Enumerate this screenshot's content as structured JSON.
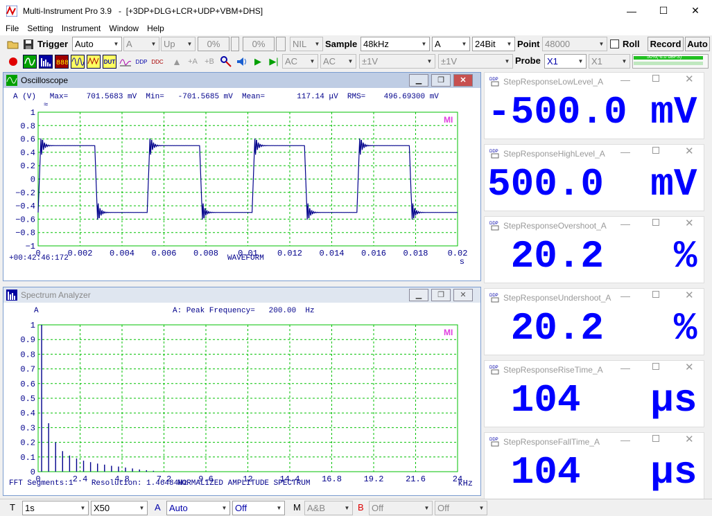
{
  "window": {
    "title": "Multi-Instrument Pro 3.9   -  [+3DP+DLG+LCR+UDP+VBM+DHS]",
    "controls": [
      "—",
      "☐",
      "✕"
    ]
  },
  "menu": [
    "File",
    "Setting",
    "Instrument",
    "Window",
    "Help"
  ],
  "toolbar1": {
    "trigger_label": "Trigger",
    "trigger_mode": "Auto",
    "trigger_channel": "A",
    "trigger_edge": "Up",
    "pct1": "0%",
    "pct2": "0%",
    "nil": "NIL",
    "sample_label": "Sample",
    "sample_rate": "48kHz",
    "channel": "A",
    "bits": "24Bit",
    "point_label": "Point",
    "points": "48000",
    "roll_label": "Roll",
    "record_label": "Record",
    "auto_label": "Auto"
  },
  "toolbar2": {
    "icon_dut": "DUT",
    "icon_ddp": "DDP",
    "icon_ddc": "DDC",
    "coupling_a": "AC",
    "coupling_b": "AC",
    "range_a": "±1V",
    "range_b": "±1V",
    "probe_label": "Probe",
    "probe_a": "X1",
    "probe_b": "X1",
    "level_meter": "50%(-6.0 dBFS)"
  },
  "oscilloscope": {
    "title": "Oscilloscope",
    "header": "A (V)   Max=    701.5683 mV  Min=   -701.5685 mV  Mean=       117.14 μV  RMS=    496.69300 mV",
    "mi": "MI",
    "y_ticks": [
      "1",
      "0.8",
      "0.6",
      "0.4",
      "0.2",
      "0",
      "−0.2",
      "−0.4",
      "−0.6",
      "−0.8",
      "−1"
    ],
    "x_ticks": [
      "0",
      "0.002",
      "0.004",
      "0.006",
      "0.008",
      "0.01",
      "0.012",
      "0.014",
      "0.016",
      "0.018",
      "0.02"
    ],
    "x_unit": "s",
    "timestamp": "+00:42:46:172",
    "footer": "WAVEFORM"
  },
  "spectrum": {
    "title": "Spectrum Analyzer",
    "channel": "A",
    "header": "A: Peak Frequency=   200.00  Hz",
    "mi": "MI",
    "y_ticks": [
      "1",
      "0.9",
      "0.8",
      "0.7",
      "0.6",
      "0.5",
      "0.4",
      "0.3",
      "0.2",
      "0.1",
      "0"
    ],
    "x_ticks": [
      "0",
      "2.4",
      "4.8",
      "7.2",
      "9.6",
      "12",
      "14.4",
      "16.8",
      "19.2",
      "21.6",
      "24"
    ],
    "x_unit": "kHz",
    "footer_left": "FFT Segments:1    Resolution: 1.46484Hz",
    "footer_center": "NORMALIZED AMPLITUDE SPECTRUM"
  },
  "ddp_meters": [
    {
      "title": "StepResponseLowLevel_A",
      "value": "-500.0 mV"
    },
    {
      "title": "StepResponseHighLevel_A",
      "value": "500.0  mV"
    },
    {
      "title": "StepResponseOvershoot_A",
      "value": " 20.2   %"
    },
    {
      "title": "StepResponseUndershoot_A",
      "value": " 20.2   %"
    },
    {
      "title": "StepResponseRiseTime_A",
      "value": " 104   μs"
    },
    {
      "title": "StepResponseFallTime_A",
      "value": " 104   μs"
    }
  ],
  "statusbar": {
    "t_label": "T",
    "time_base": "1s",
    "zoom": "X50",
    "a_label": "A",
    "a_mode": "Auto",
    "a_off": "Off",
    "m_label": "M",
    "m_mode": "A&B",
    "b_label": "B",
    "b_off1": "Off",
    "b_off2": "Off"
  },
  "colors": {
    "trace": "#00008b",
    "grid": "#00c000",
    "meter_value": "#0000ff",
    "window_caption": "#bfcde4"
  },
  "waveform_data": {
    "type": "line",
    "x_range": [
      0,
      0.02
    ],
    "y_range": [
      -1,
      1
    ],
    "frequency_hz": 200,
    "low_level": -0.5,
    "high_level": 0.5,
    "overshoot_peak": 0.7016,
    "rising_edges": [
      0,
      0.0052,
      0.0102,
      0.0152
    ],
    "falling_edges": [
      0.0027,
      0.0077,
      0.0127,
      0.0177
    ]
  },
  "spectrum_data": {
    "type": "bar",
    "x_range_khz": [
      0,
      24
    ],
    "y_range": [
      0,
      1
    ],
    "peaks_khz": [
      0.2,
      0.6,
      1.0,
      1.4,
      1.8,
      2.2,
      2.6,
      3.0,
      3.4,
      3.8,
      4.2,
      4.6,
      5.0,
      5.4,
      5.8,
      6.2,
      6.6
    ],
    "peaks_amp": [
      1.0,
      0.33,
      0.2,
      0.14,
      0.11,
      0.09,
      0.075,
      0.065,
      0.055,
      0.048,
      0.04,
      0.035,
      0.028,
      0.022,
      0.015,
      0.01,
      0.006
    ]
  }
}
